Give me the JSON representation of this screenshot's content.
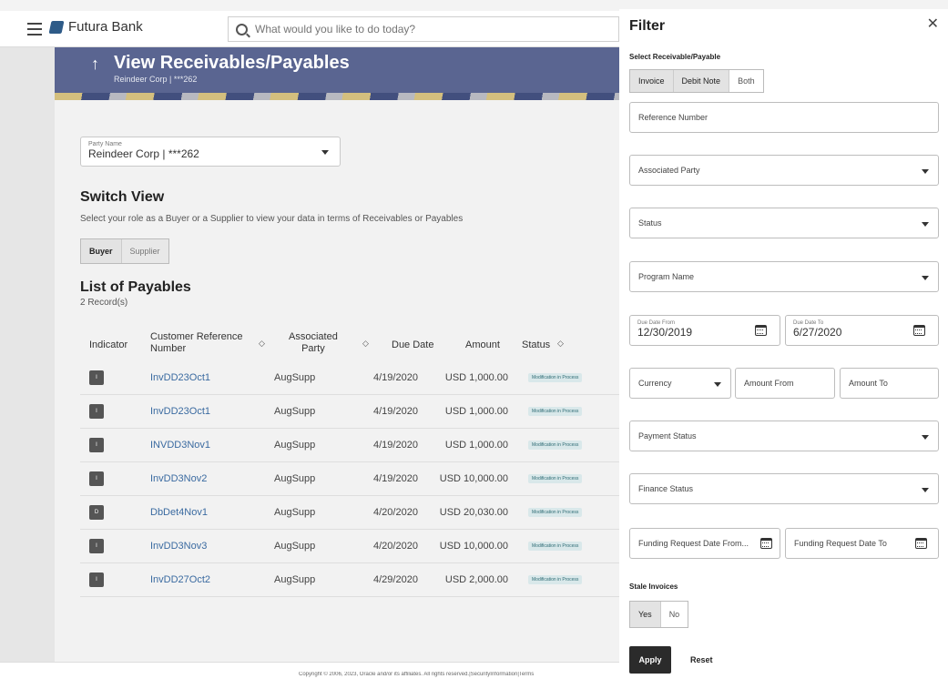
{
  "header": {
    "brand": "Futura Bank",
    "search_placeholder": "What would you like to do today?"
  },
  "page": {
    "title": "View Receivables/Payables",
    "subtitle": "Reindeer Corp | ***262"
  },
  "party": {
    "label": "Party Name",
    "value": "Reindeer Corp | ***262"
  },
  "switch_view": {
    "title": "Switch View",
    "description": "Select your role as a Buyer or a Supplier to view your data in terms of Receivables or Payables",
    "options": [
      "Buyer",
      "Supplier"
    ],
    "selected": "Buyer"
  },
  "list": {
    "title": "List of Payables",
    "count": "2 Record(s)",
    "columns": {
      "indicator": "Indicator",
      "customer_ref_1": "Customer Reference",
      "customer_ref_2": "Number",
      "party_1": "Associated",
      "party_2": "Party",
      "due_date": "Due Date",
      "amount": "Amount",
      "status": "Status"
    },
    "rows": [
      {
        "indicator": "I",
        "ref": "InvDD23Oct1",
        "party": "AugSupp",
        "due": "4/19/2020",
        "amount": "USD 1,000.00",
        "status": "Modification in Process"
      },
      {
        "indicator": "I",
        "ref": "InvDD23Oct1",
        "party": "AugSupp",
        "due": "4/19/2020",
        "amount": "USD 1,000.00",
        "status": "Modification in Process"
      },
      {
        "indicator": "I",
        "ref": "INVDD3Nov1",
        "party": "AugSupp",
        "due": "4/19/2020",
        "amount": "USD 1,000.00",
        "status": "Modification in Process"
      },
      {
        "indicator": "I",
        "ref": "InvDD3Nov2",
        "party": "AugSupp",
        "due": "4/19/2020",
        "amount": "USD 10,000.00",
        "status": "Modification in Process"
      },
      {
        "indicator": "D",
        "ref": "DbDet4Nov1",
        "party": "AugSupp",
        "due": "4/20/2020",
        "amount": "USD 20,030.00",
        "status": "Modification in Process"
      },
      {
        "indicator": "I",
        "ref": "InvDD3Nov3",
        "party": "AugSupp",
        "due": "4/20/2020",
        "amount": "USD 10,000.00",
        "status": "Modification in Process"
      },
      {
        "indicator": "I",
        "ref": "InvDD27Oct2",
        "party": "AugSupp",
        "due": "4/29/2020",
        "amount": "USD 2,000.00",
        "status": "Modification in Process"
      }
    ]
  },
  "footer": {
    "text": "Copyright © 2006, 2023, Oracle and/or its affiliates. All rights reserved.|SecurityInformation|Terms"
  },
  "filter": {
    "title": "Filter",
    "select_label": "Select Receivable/Payable",
    "select_options": [
      "Invoice",
      "Debit Note",
      "Both"
    ],
    "reference_number": "Reference Number",
    "associated_party": "Associated Party",
    "status": "Status",
    "program_name": "Program Name",
    "due_date_from_label": "Due Date From",
    "due_date_from": "12/30/2019",
    "due_date_to_label": "Due Date To",
    "due_date_to": "6/27/2020",
    "currency": "Currency",
    "amount_from": "Amount From",
    "amount_to": "Amount To",
    "payment_status": "Payment Status",
    "finance_status": "Finance Status",
    "funding_from": "Funding Request Date From...",
    "funding_to": "Funding Request Date To",
    "stale_label": "Stale Invoices",
    "stale_options": [
      "Yes",
      "No"
    ],
    "apply": "Apply",
    "reset": "Reset"
  }
}
